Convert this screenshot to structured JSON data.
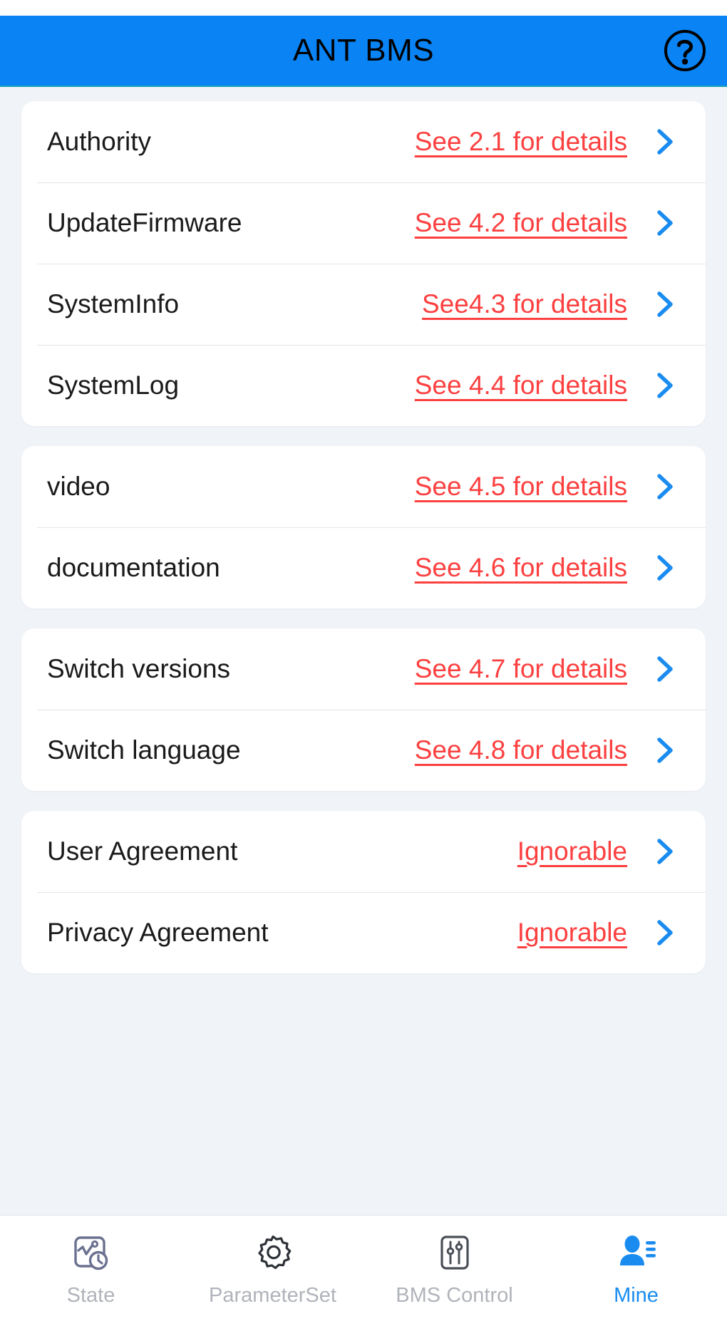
{
  "header": {
    "title": "ANT BMS",
    "help_icon": "question-circle-icon",
    "background_color": "#0a84f5"
  },
  "colors": {
    "accent": "#0a84f5",
    "value_link": "#fc4040",
    "page_background": "#f0f3f7",
    "card_background": "#ffffff",
    "tab_inactive": "#b0b3ba",
    "tab_active": "#1a8cf0"
  },
  "cards": [
    {
      "rows": [
        {
          "label": "Authority",
          "value": "See 2.1 for details",
          "chevron": "chevron-right-icon"
        },
        {
          "label": "UpdateFirmware",
          "value": "See 4.2 for details",
          "chevron": "chevron-right-icon"
        },
        {
          "label": "SystemInfo",
          "value": "See4.3 for details",
          "chevron": "chevron-right-icon"
        },
        {
          "label": "SystemLog",
          "value": "See 4.4 for details",
          "chevron": "chevron-right-icon"
        }
      ]
    },
    {
      "rows": [
        {
          "label": "video",
          "value": "See 4.5 for details",
          "chevron": "chevron-right-icon"
        },
        {
          "label": "documentation",
          "value": "See 4.6 for details",
          "chevron": "chevron-right-icon"
        }
      ]
    },
    {
      "rows": [
        {
          "label": "Switch versions",
          "value": "See 4.7 for details",
          "chevron": "chevron-right-icon"
        },
        {
          "label": "Switch language",
          "value": "See 4.8 for details",
          "chevron": "chevron-right-icon"
        }
      ]
    },
    {
      "rows": [
        {
          "label": "User Agreement",
          "value": "Ignorable",
          "chevron": "chevron-right-icon"
        },
        {
          "label": "Privacy Agreement",
          "value": "Ignorable",
          "chevron": "chevron-right-icon"
        }
      ]
    }
  ],
  "tabbar": {
    "items": [
      {
        "label": "State",
        "icon": "chart-clock-icon",
        "active": false
      },
      {
        "label": "ParameterSet",
        "icon": "gear-icon",
        "active": false
      },
      {
        "label": "BMS Control",
        "icon": "sliders-icon",
        "active": false
      },
      {
        "label": "Mine",
        "icon": "user-list-icon",
        "active": true
      }
    ]
  }
}
